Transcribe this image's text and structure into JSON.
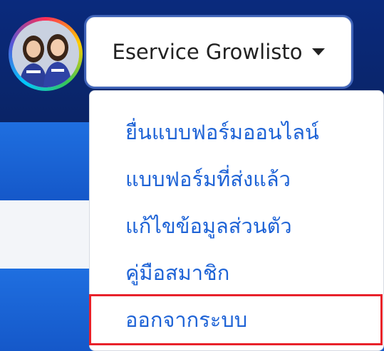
{
  "header": {
    "user": {
      "name": "Eservice Growlisto",
      "avatar_icon": "user-avatar-photo"
    }
  },
  "dropdown": {
    "items": [
      {
        "label": "ยื่นแบบฟอร์มออนไลน์"
      },
      {
        "label": "แบบฟอร์มที่ส่งแล้ว"
      },
      {
        "label": "แก้ไขข้อมูลส่วนตัว"
      },
      {
        "label": "คู่มือสมาชิก"
      },
      {
        "label": "ออกจากระบบ"
      }
    ],
    "highlighted_item_index": 4,
    "highlight_color": "#e8212a",
    "link_color": "#1e63d6"
  },
  "theme": {
    "header_bg": "#0a2a7d",
    "band_bg": "#1f6fe0"
  }
}
